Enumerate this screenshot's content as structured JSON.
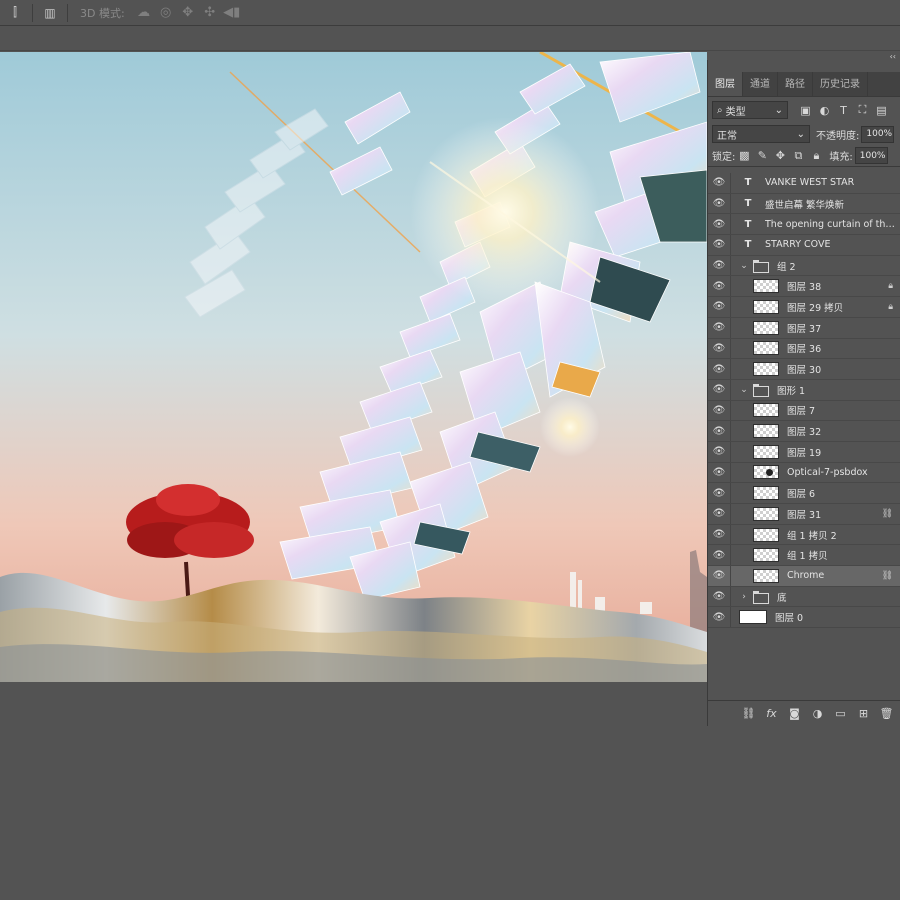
{
  "options_bar": {
    "mode3d_label": "3D 模式:",
    "icons": [
      "align-icon",
      "distribute-icon",
      "orbit-3d-icon",
      "roll-3d-icon",
      "pan-3d-icon",
      "slide-3d-icon",
      "scale-3d-icon"
    ]
  },
  "panel": {
    "collapse_glyph": "‹‹",
    "tabs": [
      "图层",
      "通道",
      "路径",
      "历史记录"
    ],
    "filter": {
      "label": "类型",
      "icons": [
        "image-filter-icon",
        "adjustment-filter-icon",
        "type-filter-icon",
        "shape-filter-icon",
        "smart-object-filter-icon"
      ]
    },
    "blend_mode": "正常",
    "opacity_label": "不透明度:",
    "opacity_value": "100%",
    "lock_label": "锁定:",
    "fill_label": "填充:",
    "fill_value": "100%",
    "layers": [
      {
        "name": "VANKE WEST STAR",
        "kind": "text",
        "depth": 0
      },
      {
        "name": "盛世启幕 繁华焕新",
        "kind": "text",
        "depth": 0
      },
      {
        "name": "The opening curtain of the g...",
        "kind": "text",
        "depth": 0
      },
      {
        "name": "STARRY COVE",
        "kind": "text",
        "depth": 0
      },
      {
        "name": "组 2",
        "kind": "group",
        "depth": 0,
        "expanded": true
      },
      {
        "name": "图层 38",
        "kind": "pixel",
        "depth": 1,
        "badge": "lock"
      },
      {
        "name": "图层 29 拷贝",
        "kind": "pixel",
        "depth": 1,
        "badge": "lock"
      },
      {
        "name": "图层 37",
        "kind": "pixel",
        "depth": 1
      },
      {
        "name": "图层 36",
        "kind": "pixel",
        "depth": 1
      },
      {
        "name": "图层 30",
        "kind": "pixel",
        "depth": 1
      },
      {
        "name": "图形 1",
        "kind": "group",
        "depth": 0,
        "expanded": true
      },
      {
        "name": "图层 7",
        "kind": "pixel",
        "depth": 1
      },
      {
        "name": "图层 32",
        "kind": "pixel",
        "depth": 1
      },
      {
        "name": "图层 19",
        "kind": "pixel",
        "depth": 1
      },
      {
        "name": "Optical-7-psbdox",
        "kind": "pixel-optical",
        "depth": 1
      },
      {
        "name": "图层 6",
        "kind": "pixel",
        "depth": 1
      },
      {
        "name": "图层 31",
        "kind": "pixel",
        "depth": 1,
        "badge": "link"
      },
      {
        "name": "组 1 拷贝 2",
        "kind": "pixel",
        "depth": 1
      },
      {
        "name": "组 1 拷贝",
        "kind": "pixel",
        "depth": 1
      },
      {
        "name": "Chrome",
        "kind": "pixel",
        "depth": 1,
        "badge": "link",
        "selected": true
      },
      {
        "name": "底",
        "kind": "group",
        "depth": 0,
        "expanded": false
      },
      {
        "name": "图层 0",
        "kind": "background",
        "depth": 0
      }
    ],
    "footer_icons": [
      "link-layers-icon",
      "fx-icon",
      "add-mask-icon",
      "new-adjustment-icon",
      "new-group-icon",
      "new-layer-icon",
      "delete-layer-icon"
    ]
  },
  "colors": {
    "ui_bg": "#535353",
    "panel_selected": "#676767",
    "sky_top": "#a9cfdb",
    "sky_bottom": "#e7b3a2",
    "tree_red": "#b71c1c"
  }
}
